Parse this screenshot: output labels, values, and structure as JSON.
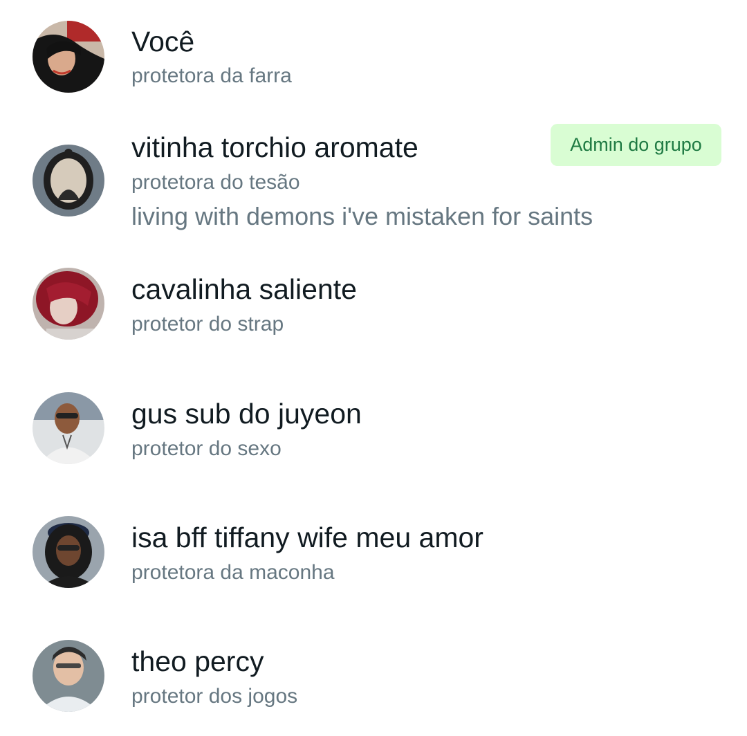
{
  "members": [
    {
      "name": "Você",
      "subtitle": "protetora da farra",
      "about": "",
      "badge": ""
    },
    {
      "name": "vitinha torchio aromate",
      "subtitle": "protetora do tesão",
      "about": "living with demons i've mistaken for saints",
      "badge": "Admin do grupo"
    },
    {
      "name": "cavalinha saliente",
      "subtitle": "protetor do strap",
      "about": "",
      "badge": ""
    },
    {
      "name": "gus sub do juyeon",
      "subtitle": "protetor do sexo",
      "about": "",
      "badge": ""
    },
    {
      "name": "isa bff tiffany wife meu amor",
      "subtitle": "protetora da maconha",
      "about": "",
      "badge": ""
    },
    {
      "name": "theo percy",
      "subtitle": "protetor dos jogos",
      "about": "",
      "badge": ""
    }
  ],
  "colors": {
    "name_text": "#111b21",
    "secondary_text": "#667781",
    "admin_badge_bg": "#d9fdd3",
    "admin_badge_text": "#1f7a43"
  }
}
